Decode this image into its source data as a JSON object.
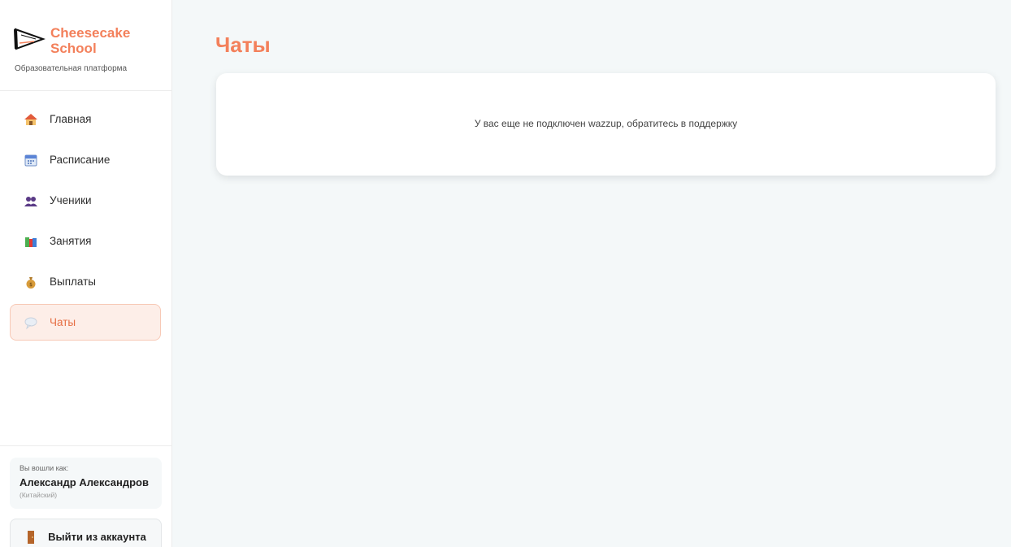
{
  "brand": {
    "name": "Cheesecake School",
    "subtitle": "Образовательная платформа",
    "accent_color": "#f3805b"
  },
  "nav": {
    "items": [
      {
        "label": "Главная",
        "icon": "house-icon"
      },
      {
        "label": "Расписание",
        "icon": "calendar-icon"
      },
      {
        "label": "Ученики",
        "icon": "users-icon"
      },
      {
        "label": "Занятия",
        "icon": "books-icon"
      },
      {
        "label": "Выплаты",
        "icon": "money-bag-icon"
      },
      {
        "label": "Чаты",
        "icon": "speech-bubble-icon",
        "active": true
      }
    ]
  },
  "user": {
    "caption": "Вы вошли как:",
    "name": "Александр Александров",
    "role": "(Китайский)"
  },
  "logout": {
    "label": "Выйти из аккаунта",
    "icon": "door-icon"
  },
  "main": {
    "title": "Чаты",
    "message": "У вас еще не подключен wazzup, обратитесь в поддержку"
  }
}
